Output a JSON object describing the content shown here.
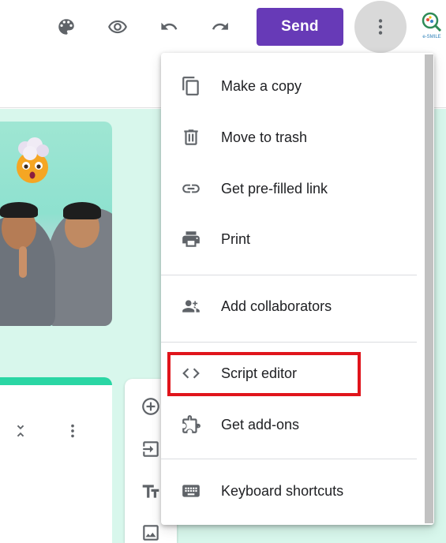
{
  "toolbar": {
    "icons": [
      "palette-icon",
      "eye-icon",
      "undo-icon",
      "redo-icon"
    ],
    "send_label": "Send",
    "more_icon": "vertical-dots-icon",
    "logo_text": "e-SMILE"
  },
  "colors": {
    "accent": "#673ab7",
    "canvas_bg": "#d8f7ec",
    "question_accent": "#2ad6a4",
    "highlight": "#e0141b",
    "icon_gray": "#5f6368"
  },
  "menu": {
    "items": [
      {
        "label": "Make a copy",
        "icon": "copy-icon"
      },
      {
        "label": "Move to trash",
        "icon": "trash-icon"
      },
      {
        "label": "Get pre-filled link",
        "icon": "link-icon"
      },
      {
        "label": "Print",
        "icon": "print-icon"
      },
      {
        "label": "Add collaborators",
        "icon": "add-people-icon"
      },
      {
        "label": "Script editor",
        "icon": "code-icon"
      },
      {
        "label": "Get add-ons",
        "icon": "puzzle-icon"
      },
      {
        "label": "Keyboard shortcuts",
        "icon": "keyboard-icon"
      }
    ],
    "highlighted_item": "Script editor"
  },
  "side_toolbar": {
    "icons": [
      "add-circle-icon",
      "import-questions-icon",
      "title-text-icon",
      "image-icon"
    ]
  },
  "question_card": {
    "icons": [
      "collapse-icon",
      "vertical-dots-icon"
    ]
  }
}
